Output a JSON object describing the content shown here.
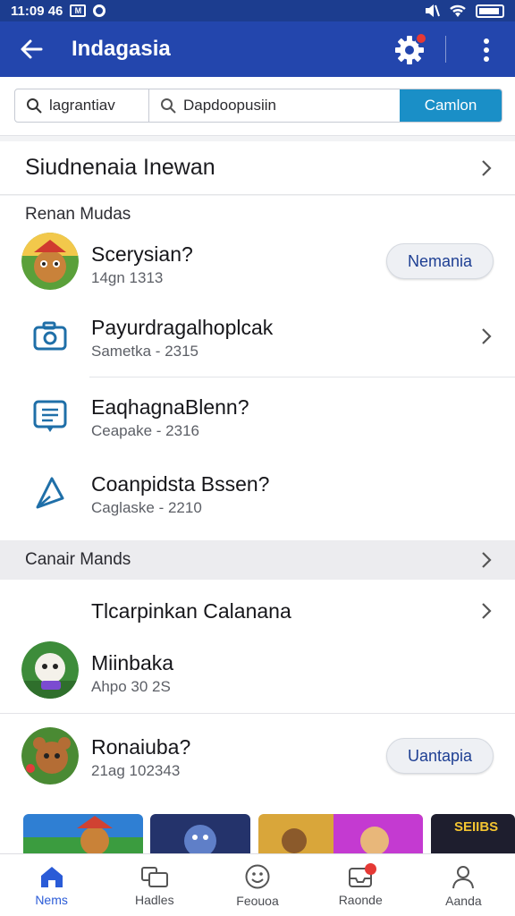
{
  "status_bar": {
    "time": "11:09 46",
    "box_glyph": "M"
  },
  "app_bar": {
    "title": "Indagasia"
  },
  "search": {
    "field1_value": "lagrantiav",
    "field2_value": "Dapdoopusiin",
    "button_label": "Camlon"
  },
  "section1": {
    "title": "Siudnenaia Inewan"
  },
  "subsection_label": "Renan Mudas",
  "rows": [
    {
      "title": "Scerysian?",
      "sub": "14gn 1313",
      "action": "Nemania"
    },
    {
      "title": "Payurdragalhoplcak",
      "sub": "Sametka - 2315"
    },
    {
      "title": "EaqhagnaBlenn?",
      "sub": "Ceapake - 2316"
    },
    {
      "title": "Coanpidsta Bssen?",
      "sub": "Caglaske - 2210"
    }
  ],
  "section2": {
    "title": "Canair Mands"
  },
  "section2_item": {
    "title": "Tlcarpinkan Calanana"
  },
  "rows2": [
    {
      "title": "Miinbaka",
      "sub": "Ahpo 30 2S"
    },
    {
      "title": "Ronaiuba?",
      "sub": "21ag 102343",
      "action": "Uantapia"
    }
  ],
  "thumb_label": "SEIIBS",
  "bottom_nav": [
    {
      "label": "Nems",
      "icon": "home-icon",
      "active": true
    },
    {
      "label": "Hadles",
      "icon": "folders-icon"
    },
    {
      "label": "Feouoa",
      "icon": "smiley-icon"
    },
    {
      "label": "Raonde",
      "icon": "inbox-icon"
    },
    {
      "label": "Aanda",
      "icon": "person-icon"
    }
  ],
  "colors": {
    "app_bar": "#2346ad",
    "status_bar": "#1c3d8f",
    "search_button": "#1a8fc7",
    "active_nav": "#2a5bd7",
    "badge": "#e53935"
  }
}
